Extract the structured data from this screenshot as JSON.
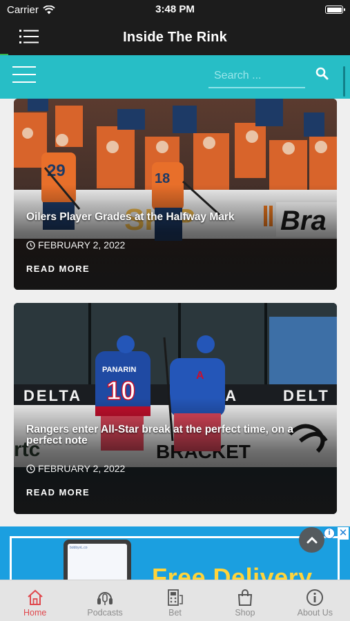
{
  "status_bar": {
    "carrier": "Carrier",
    "time": "3:48 PM"
  },
  "app_header": {
    "title": "Inside The Rink"
  },
  "site_bar": {
    "search_placeholder": "Search ...",
    "accent_color": "#27bec6"
  },
  "articles": [
    {
      "title": "Oilers Player Grades at the Halfway Mark",
      "date": "FEBRUARY 2, 2022",
      "read_more": "READ MORE",
      "image_signage": [
        "SKIP",
        "Bra"
      ]
    },
    {
      "title": "Rangers enter All-Star break at the perfect time, on a perfect note",
      "date": "FEBRUARY 2, 2022",
      "read_more": "READ MORE",
      "image_signage": [
        "DELTA",
        "DELTA",
        "DELT",
        "PANARIN",
        "10",
        "A",
        "BRACKET"
      ]
    }
  ],
  "ad": {
    "headline": "Free Delivery",
    "info_label": "i",
    "close_label": "✕",
    "phone_app_name": "bobbyvL.co"
  },
  "tab_bar": {
    "items": [
      {
        "label": "Home",
        "icon": "home-icon",
        "active": true
      },
      {
        "label": "Podcasts",
        "icon": "podcast-icon",
        "active": false
      },
      {
        "label": "Bet",
        "icon": "bet-icon",
        "active": false
      },
      {
        "label": "Shop",
        "icon": "shopping-bag-icon",
        "active": false
      },
      {
        "label": "About Us",
        "icon": "info-icon",
        "active": false
      }
    ],
    "active_color": "#e0474c"
  }
}
